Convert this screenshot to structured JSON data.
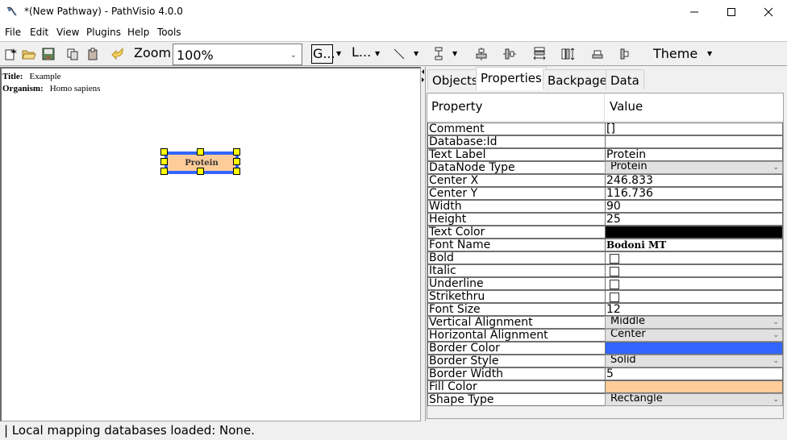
{
  "window": {
    "title": "*(New Pathway) - PathVisio 4.0.0",
    "controls": [
      "minimize-icon",
      "maximize-icon",
      "close-icon"
    ]
  },
  "menu": [
    "File",
    "Edit",
    "View",
    "Plugins",
    "Help",
    "Tools"
  ],
  "toolbar": {
    "icons": [
      "new-file-icon",
      "open-folder-icon",
      "save-icon",
      "copy-icon",
      "paste-icon",
      "undo-icon"
    ],
    "zoom_label": "Zoom:",
    "zoom_value": "100%",
    "group_label": "G...",
    "line_label": "L...",
    "align_icons": [
      "align-center-horizontal-icon",
      "align-center-vertical-icon",
      "stack-vertical-icon",
      "stack-horizontal-icon",
      "align-top-icon",
      "align-left-icon"
    ],
    "theme_label": "Theme"
  },
  "canvas": {
    "title_label": "Title:",
    "title_value": "Example",
    "organism_label": "Organism:",
    "organism_value": "Homo sapiens",
    "node_label": "Protein",
    "node_fill": "#ffcc99",
    "node_border": "#3366ff"
  },
  "panel": {
    "tabs": [
      "Objects",
      "Properties",
      "Backpage",
      "Data"
    ],
    "active_tab": "Properties",
    "headers": {
      "property": "Property",
      "value": "Value"
    },
    "rows": [
      {
        "property": "Comment",
        "value": "[]",
        "type": "text"
      },
      {
        "property": "Database:Id",
        "value": "",
        "type": "text"
      },
      {
        "property": "Text Label",
        "value": "Protein",
        "type": "text"
      },
      {
        "property": "DataNode Type",
        "value": "Protein",
        "type": "combo"
      },
      {
        "property": "Center X",
        "value": "246.833",
        "type": "text"
      },
      {
        "property": "Center Y",
        "value": "116.736",
        "type": "text"
      },
      {
        "property": "Width",
        "value": "90",
        "type": "text"
      },
      {
        "property": "Height",
        "value": "25",
        "type": "text"
      },
      {
        "property": "Text Color",
        "value": "#000000",
        "type": "color"
      },
      {
        "property": "Font Name",
        "value": "Bodoni MT",
        "type": "font"
      },
      {
        "property": "Bold",
        "value": false,
        "type": "check"
      },
      {
        "property": "Italic",
        "value": false,
        "type": "check"
      },
      {
        "property": "Underline",
        "value": false,
        "type": "check"
      },
      {
        "property": "Strikethru",
        "value": false,
        "type": "check"
      },
      {
        "property": "Font Size",
        "value": "12",
        "type": "text"
      },
      {
        "property": "Vertical Alignment",
        "value": "Middle",
        "type": "combo"
      },
      {
        "property": "Horizontal Alignment",
        "value": "Center",
        "type": "combo"
      },
      {
        "property": "Border Color",
        "value": "#3366ff",
        "type": "color"
      },
      {
        "property": "Border Style",
        "value": "Solid",
        "type": "combo"
      },
      {
        "property": "Border Width",
        "value": "5",
        "type": "text"
      },
      {
        "property": "Fill Color",
        "value": "#ffcc99",
        "type": "color"
      },
      {
        "property": "Shape Type",
        "value": "Rectangle",
        "type": "combo"
      }
    ]
  },
  "status": "| Local mapping databases loaded: None."
}
